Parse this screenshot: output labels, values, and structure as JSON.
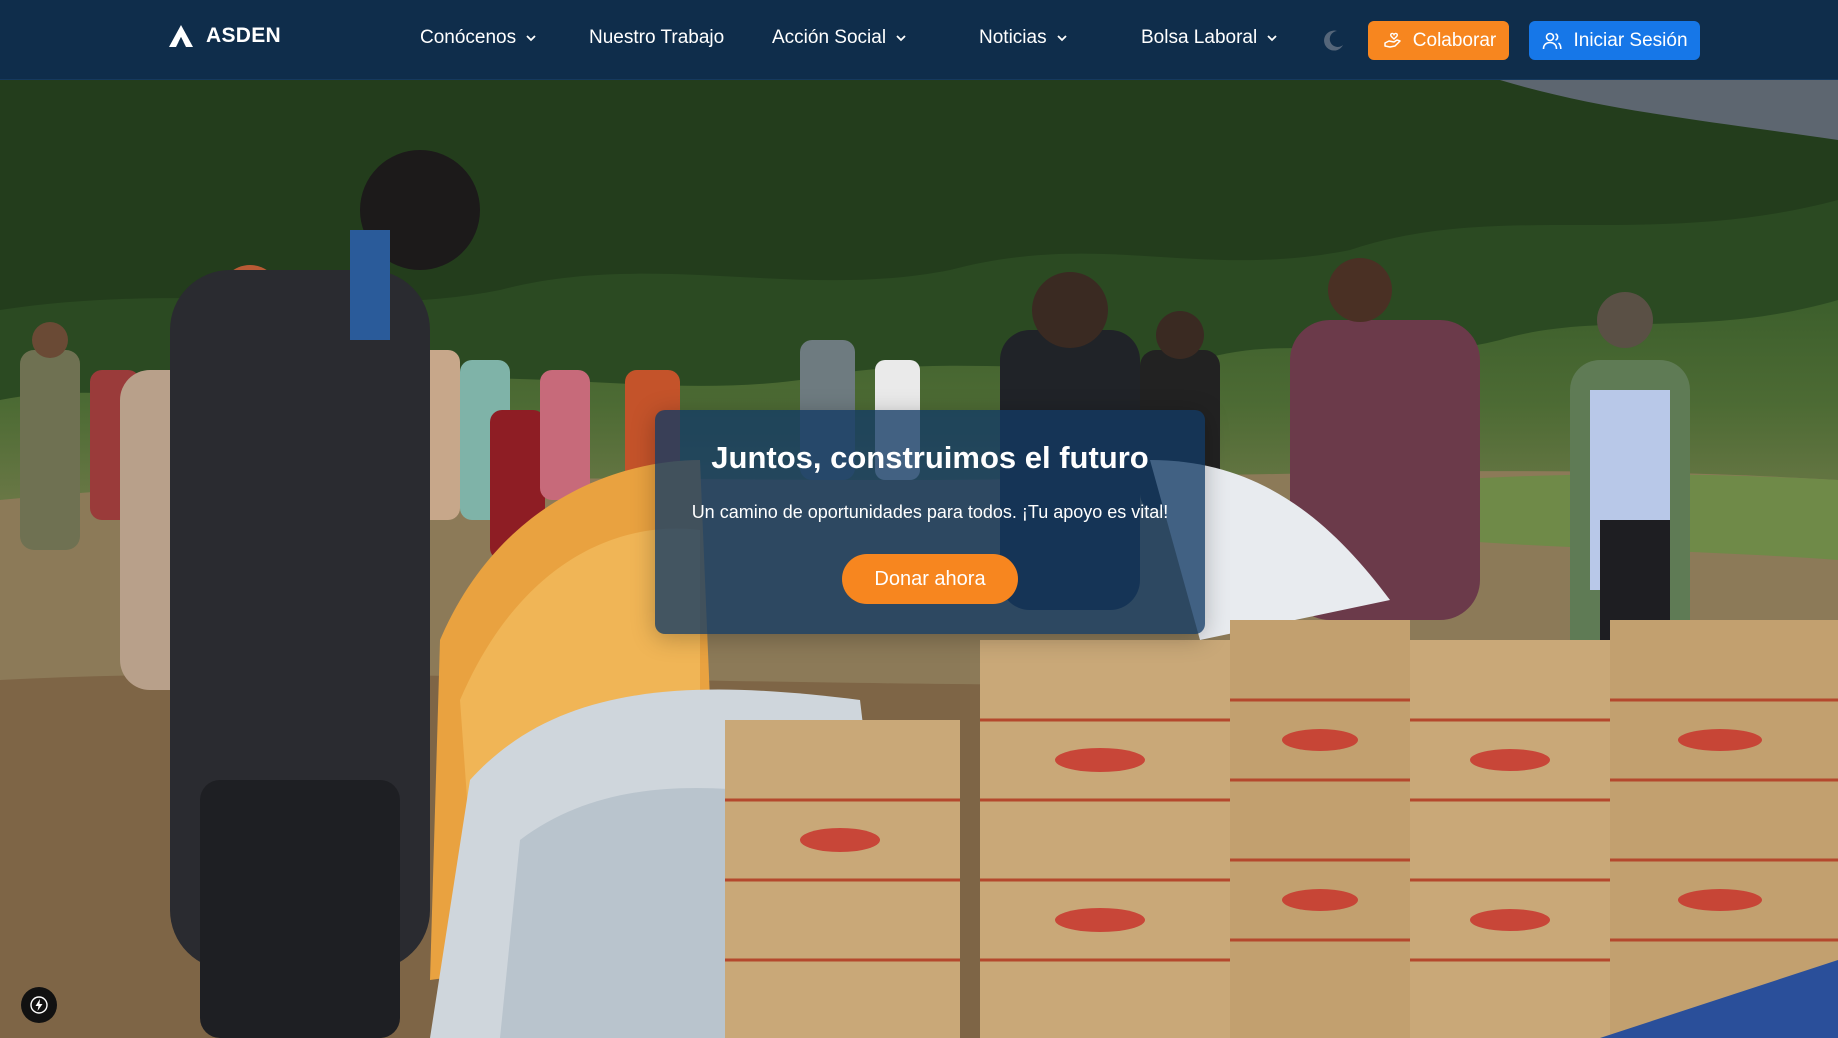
{
  "brand": {
    "name": "ASDEN"
  },
  "nav": {
    "items": [
      {
        "label": "Conócenos",
        "has_dropdown": true
      },
      {
        "label": "Nuestro Trabajo",
        "has_dropdown": false
      },
      {
        "label": "Acción Social",
        "has_dropdown": true
      },
      {
        "label": "Noticias",
        "has_dropdown": true
      },
      {
        "label": "Bolsa Laboral",
        "has_dropdown": true
      }
    ],
    "theme_toggle_icon": "moon-icon",
    "colaborar_label": "Colaborar",
    "login_label": "Iniciar Sesión"
  },
  "hero": {
    "title": "Juntos, construimos el futuro",
    "subtitle": "Un camino de oportunidades para todos. ¡Tu apoyo es vital!",
    "cta_label": "Donar ahora",
    "image_icon": "hero-photo"
  },
  "colors": {
    "navbar_bg": "#0f2d4b",
    "accent_orange": "#f7861f",
    "primary_blue": "#1677e8",
    "card_bg": "rgba(18,58,100,0.78)"
  },
  "floating_button_icon": "lightning-icon"
}
